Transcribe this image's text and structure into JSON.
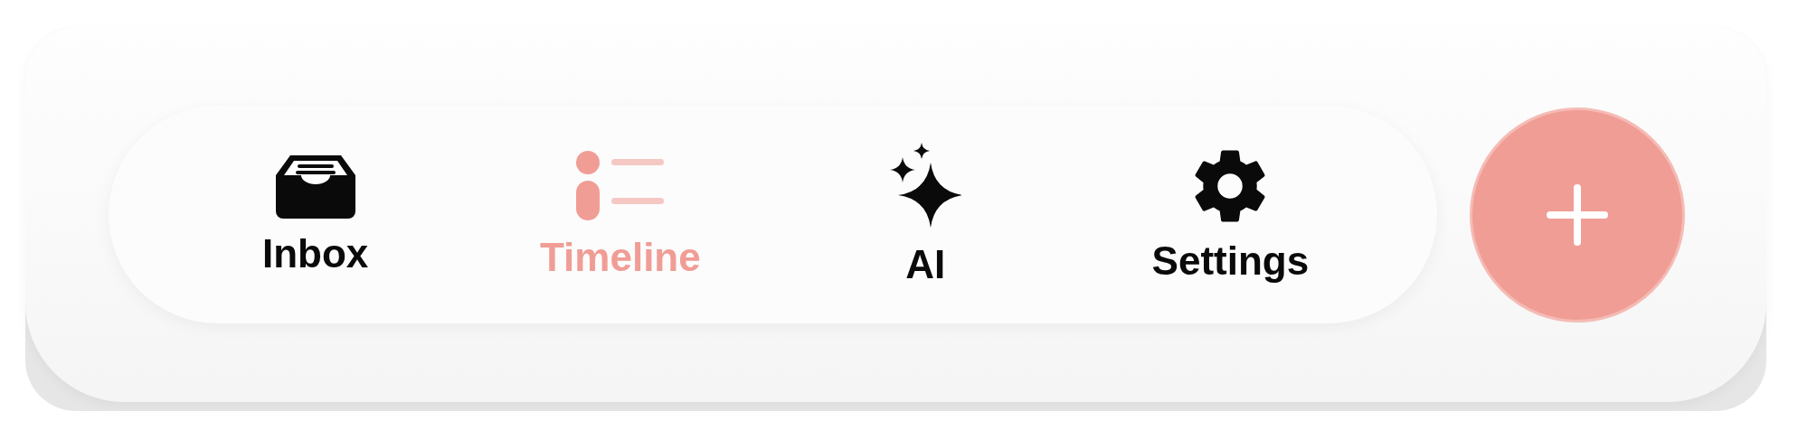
{
  "tab_bar": {
    "tabs": [
      {
        "kind": "inbox",
        "label": "Inbox",
        "selected": false
      },
      {
        "kind": "timeline",
        "label": "Timeline",
        "selected": true
      },
      {
        "kind": "ai",
        "label": "AI",
        "selected": false
      },
      {
        "kind": "settings",
        "label": "Settings",
        "selected": false
      }
    ]
  },
  "add_button": {
    "kind": "plus"
  }
}
